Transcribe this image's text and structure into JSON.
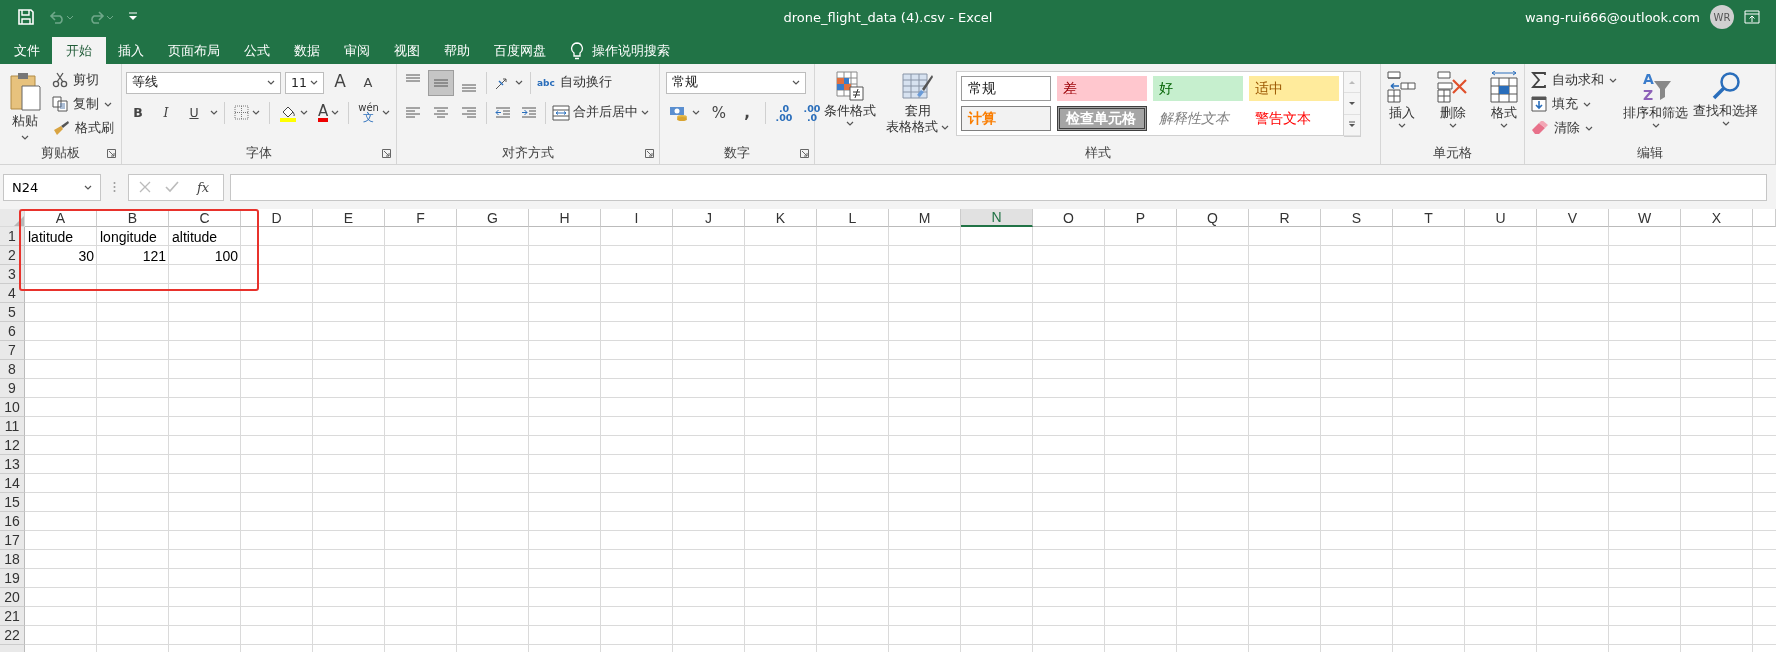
{
  "window": {
    "title": "drone_flight_data (4).csv  -  Excel",
    "account": "wang-rui666@outlook.com",
    "avatar_initials": "WR"
  },
  "tabs": [
    {
      "label": "文件",
      "selected": false
    },
    {
      "label": "开始",
      "selected": true
    },
    {
      "label": "插入",
      "selected": false
    },
    {
      "label": "页面布局",
      "selected": false
    },
    {
      "label": "公式",
      "selected": false
    },
    {
      "label": "数据",
      "selected": false
    },
    {
      "label": "审阅",
      "selected": false
    },
    {
      "label": "视图",
      "selected": false
    },
    {
      "label": "帮助",
      "selected": false
    },
    {
      "label": "百度网盘",
      "selected": false
    }
  ],
  "tell_me": {
    "label": "操作说明搜索"
  },
  "ribbon": {
    "groups": [
      {
        "kind": "clipboard",
        "label": "剪贴板",
        "paste": "粘贴",
        "items": [
          {
            "kind": "cut",
            "label": "剪切"
          },
          {
            "kind": "copy",
            "label": "复制"
          },
          {
            "kind": "brush",
            "label": "格式刷"
          }
        ]
      },
      {
        "kind": "font",
        "label": "字体",
        "font_name": "等线",
        "font_size": "11",
        "grow": "A",
        "shrink": "A",
        "bold": "B",
        "italic": "I",
        "underline": "U",
        "font_color": "A",
        "phonetic_top": "wén",
        "phonetic_bottom": "文"
      },
      {
        "kind": "alignment",
        "label": "对齐方式",
        "vertical": [
          {
            "kind": "top",
            "selected": false
          },
          {
            "kind": "middle",
            "selected": true
          },
          {
            "kind": "bottom",
            "selected": false
          }
        ],
        "horizontal": [
          {
            "kind": "left",
            "selected": false
          },
          {
            "kind": "center",
            "selected": false
          },
          {
            "kind": "right",
            "selected": false
          }
        ],
        "wrap_icon": "abc",
        "wrap": "自动换行",
        "merge": "合并后居中"
      },
      {
        "kind": "number",
        "label": "数字",
        "format": "常规",
        "percent": "%",
        "comma": ",",
        "increase": [
          ".0",
          ".00"
        ],
        "decrease": [
          ".00",
          ".0"
        ]
      },
      {
        "kind": "styles",
        "label": "样式",
        "conditional": "条件格式",
        "table": [
          "套用",
          "表格格式"
        ],
        "cell_styles": [
          {
            "kind": "normal",
            "label": "常规"
          },
          {
            "kind": "bad",
            "label": "差"
          },
          {
            "kind": "good",
            "label": "好"
          },
          {
            "kind": "neutral",
            "label": "适中"
          },
          {
            "kind": "calculation",
            "label": "计算"
          },
          {
            "kind": "check",
            "label": "检查单元格"
          },
          {
            "kind": "explanatory",
            "label": "解释性文本"
          },
          {
            "kind": "warning",
            "label": "警告文本"
          }
        ]
      },
      {
        "kind": "cells",
        "label": "单元格",
        "buttons": [
          {
            "kind": "insert",
            "label": "插入"
          },
          {
            "kind": "delete",
            "label": "删除"
          },
          {
            "kind": "format",
            "label": "格式"
          }
        ]
      },
      {
        "kind": "editing",
        "label": "编辑",
        "small": [
          {
            "kind": "autosum",
            "label": "自动求和"
          },
          {
            "kind": "fill",
            "label": "填充"
          },
          {
            "kind": "clear",
            "label": "清除"
          }
        ],
        "big": [
          {
            "kind": "sort",
            "label": "排序和筛选",
            "icon_letters": [
              "A",
              "Z"
            ]
          },
          {
            "kind": "find",
            "label": "查找和选择"
          }
        ]
      }
    ]
  },
  "formula_bar": {
    "name_box": "N24",
    "function_label": "fx"
  },
  "sheet": {
    "columns": [
      {
        "label": "A",
        "selected": false
      },
      {
        "label": "B",
        "selected": false
      },
      {
        "label": "C",
        "selected": false
      },
      {
        "label": "D",
        "selected": false
      },
      {
        "label": "E",
        "selected": false
      },
      {
        "label": "F",
        "selected": false
      },
      {
        "label": "G",
        "selected": false
      },
      {
        "label": "H",
        "selected": false
      },
      {
        "label": "I",
        "selected": false
      },
      {
        "label": "J",
        "selected": false
      },
      {
        "label": "K",
        "selected": false
      },
      {
        "label": "L",
        "selected": false
      },
      {
        "label": "M",
        "selected": false
      },
      {
        "label": "N",
        "selected": true
      },
      {
        "label": "O",
        "selected": false
      },
      {
        "label": "P",
        "selected": false
      },
      {
        "label": "Q",
        "selected": false
      },
      {
        "label": "R",
        "selected": false
      },
      {
        "label": "S",
        "selected": false
      },
      {
        "label": "T",
        "selected": false
      },
      {
        "label": "U",
        "selected": false
      },
      {
        "label": "V",
        "selected": false
      },
      {
        "label": "W",
        "selected": false
      },
      {
        "label": "X",
        "selected": false
      }
    ],
    "rows": [
      {
        "label": "1",
        "cells": [
          {
            "kind": "text",
            "text": "latitude"
          },
          {
            "kind": "text",
            "text": "longitude"
          },
          {
            "kind": "text",
            "text": "altitude"
          }
        ]
      },
      {
        "label": "2",
        "cells": [
          {
            "kind": "number",
            "text": "30"
          },
          {
            "kind": "number",
            "text": "121"
          },
          {
            "kind": "number",
            "text": "100"
          }
        ]
      },
      {
        "label": "3"
      },
      {
        "label": "4"
      },
      {
        "label": "5"
      },
      {
        "label": "6"
      },
      {
        "label": "7"
      },
      {
        "label": "8"
      },
      {
        "label": "9"
      },
      {
        "label": "10"
      },
      {
        "label": "11"
      },
      {
        "label": "12"
      },
      {
        "label": "13"
      },
      {
        "label": "14"
      },
      {
        "label": "15"
      },
      {
        "label": "16"
      },
      {
        "label": "17"
      },
      {
        "label": "18"
      },
      {
        "label": "19"
      },
      {
        "label": "20"
      },
      {
        "label": "21"
      },
      {
        "label": "22"
      }
    ]
  }
}
